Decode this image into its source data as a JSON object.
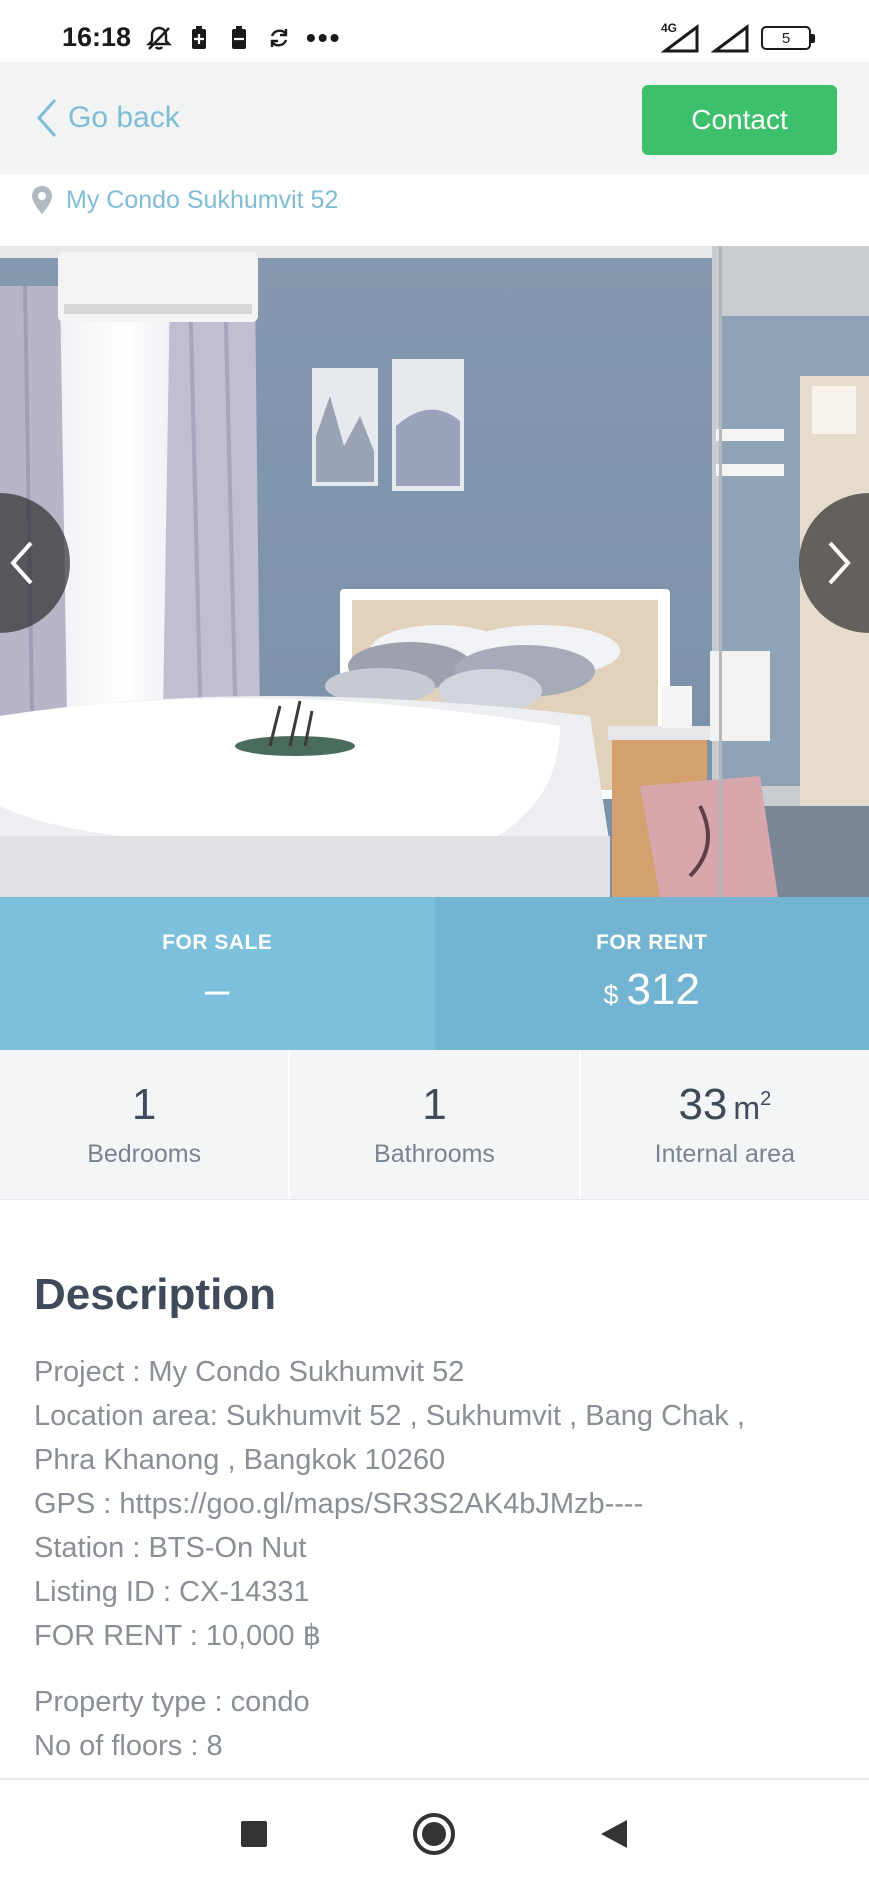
{
  "status_bar": {
    "time": "16:18",
    "network": "4G",
    "battery": "5",
    "icons": [
      "mute-icon",
      "battery-saver-icon",
      "battery-saver-icon",
      "sync-icon",
      "more-icon"
    ]
  },
  "header": {
    "back_label": "Go back",
    "contact_label": "Contact"
  },
  "location": {
    "name": "My Condo Sukhumvit 52"
  },
  "price": {
    "sale_label": "FOR SALE",
    "sale_value": "–",
    "rent_label": "FOR RENT",
    "rent_currency": "$",
    "rent_value": "312"
  },
  "stats": {
    "bedrooms_value": "1",
    "bedrooms_label": "Bedrooms",
    "bathrooms_value": "1",
    "bathrooms_label": "Bathrooms",
    "area_value": "33",
    "area_unit": "m",
    "area_unit_exp": "2",
    "area_label": "Internal area"
  },
  "description": {
    "heading": "Description",
    "lines": [
      "Project : My Condo Sukhumvit 52",
      "Location area: Sukhumvit 52 , Sukhumvit , Bang Chak ,",
      "Phra Khanong , Bangkok 10260",
      "GPS : https://goo.gl/maps/SR3S2AK4bJMzb----",
      "Station : BTS-On Nut",
      "Listing ID : CX-14331",
      "FOR RENT : 10,000 ฿"
    ],
    "lines2": [
      "Property type : condo",
      "No of floors : 8"
    ]
  },
  "colors": {
    "accent": "#7fbcd6",
    "contact": "#3dc06b",
    "sale_bg": "#7dc0dc",
    "rent_bg": "#73b4d2"
  }
}
